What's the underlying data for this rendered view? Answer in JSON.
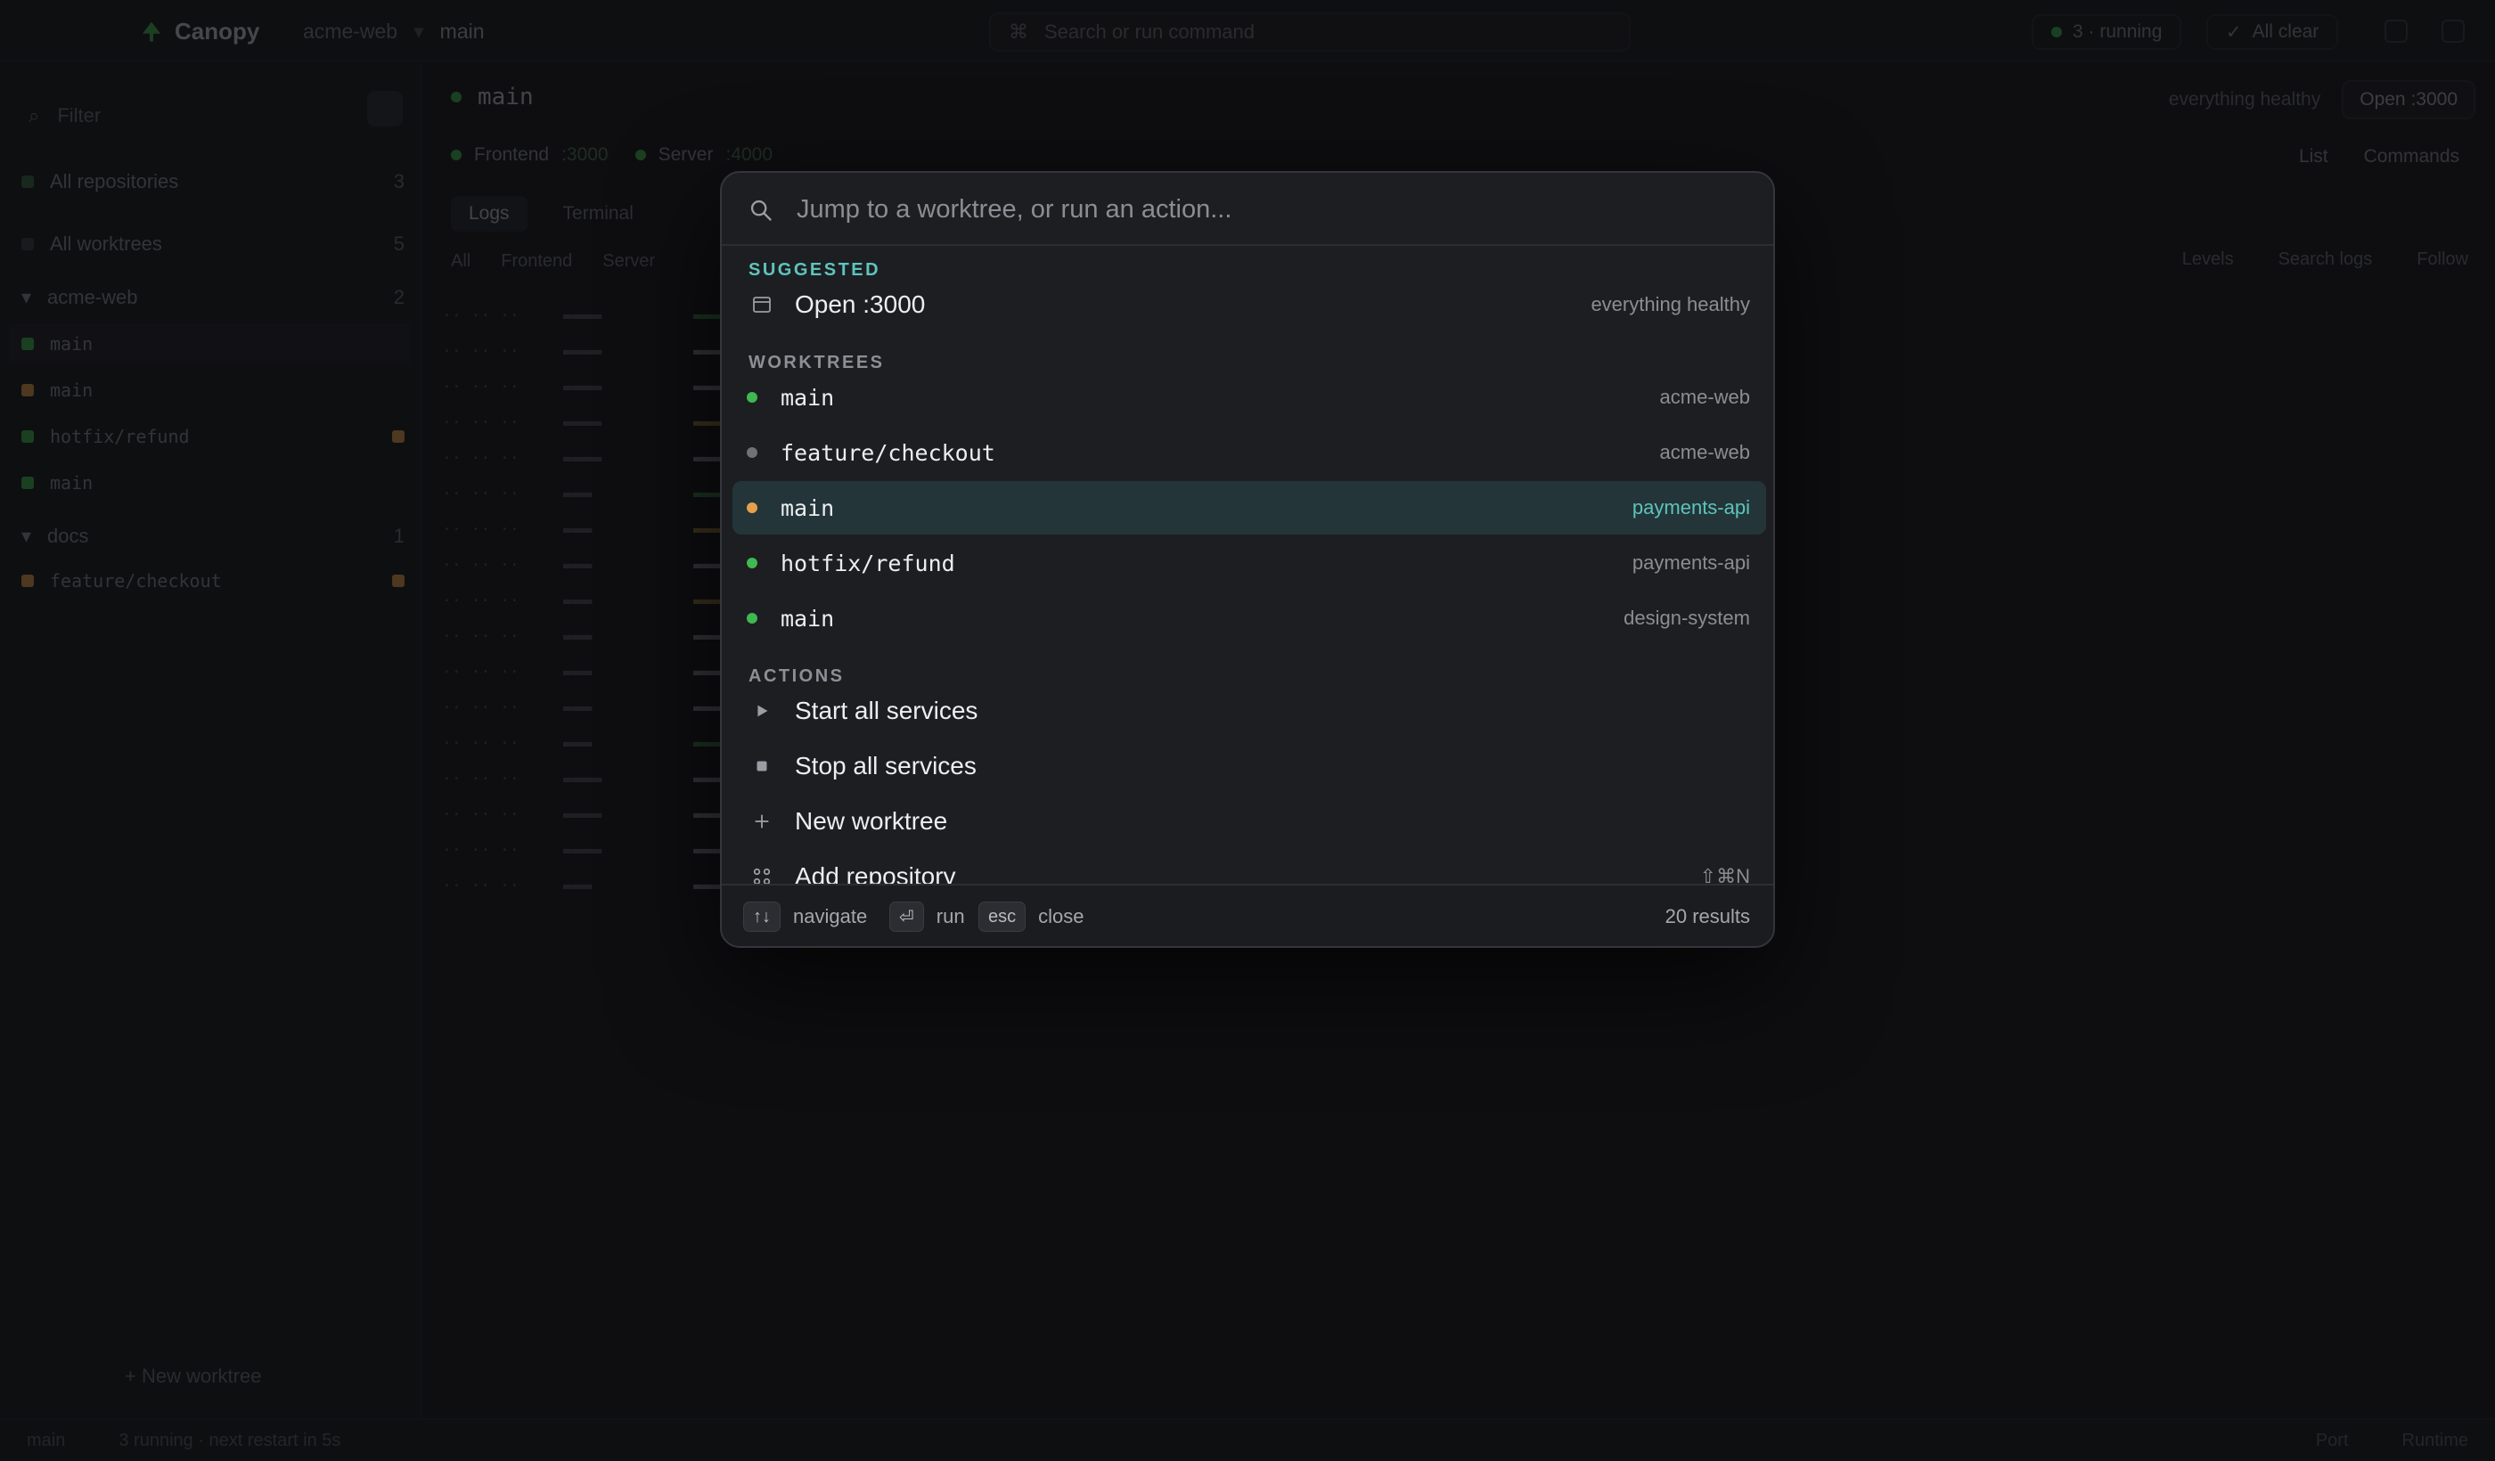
{
  "app": {
    "name": "Canopy",
    "breadcrumb": [
      "acme-web",
      "main"
    ],
    "search_placeholder": "Search or run command",
    "running_label": "3 · running",
    "all_clear_label": "All clear"
  },
  "sidebar": {
    "filter_placeholder": "Filter",
    "all_repos": {
      "label": "All repositories",
      "count": "3"
    },
    "all_worktrees": {
      "label": "All worktrees",
      "count": "5"
    },
    "groups": [
      {
        "repo": "acme-web",
        "count": "2",
        "items": [
          {
            "label": "main",
            "status": "green",
            "selected": true
          },
          {
            "label": "main",
            "status": "orange"
          },
          {
            "label": "hotfix/refund",
            "status": "green",
            "badge": true
          },
          {
            "label": "main",
            "status": "green"
          }
        ]
      },
      {
        "repo": "docs",
        "count": "1",
        "items": [
          {
            "label": "feature/checkout",
            "status": "orange",
            "badge": true
          }
        ]
      }
    ],
    "new_worktree": "New worktree"
  },
  "main": {
    "title": "main",
    "health": "everything healthy",
    "open_button": "Open :3000",
    "services": [
      {
        "name": "Frontend",
        "port": ":3000"
      },
      {
        "name": "Server",
        "port": ":4000"
      }
    ],
    "list_label": "List",
    "commands_label": "Commands",
    "log_tabs": [
      "Logs",
      "Terminal"
    ],
    "filters": [
      "All",
      "Frontend",
      "Server"
    ],
    "levels_label": "Levels",
    "search_logs_placeholder": "Search logs",
    "follow_label": "Follow"
  },
  "statusbar": {
    "left": [
      "main",
      "3 running · next restart in 5s",
      ""
    ],
    "right": [
      "Port",
      "Runtime",
      ""
    ]
  },
  "palette": {
    "placeholder": "Jump to a worktree, or run an action...",
    "sections": {
      "suggested": "SUGGESTED",
      "worktrees": "WORKTREES",
      "actions": "ACTIONS"
    },
    "suggested": [
      {
        "label": "Open :3000",
        "hint": "everything healthy",
        "icon": "browser-window-icon"
      }
    ],
    "worktrees": [
      {
        "label": "main",
        "repo": "acme-web",
        "status_color": "#3fb950"
      },
      {
        "label": "feature/checkout",
        "repo": "acme-web",
        "status_color": "#6e7177"
      },
      {
        "label": "main",
        "repo": "payments-api",
        "status_color": "#e5a04a",
        "active": true
      },
      {
        "label": "hotfix/refund",
        "repo": "payments-api",
        "status_color": "#3fb950"
      },
      {
        "label": "main",
        "repo": "design-system",
        "status_color": "#3fb950"
      }
    ],
    "actions": [
      {
        "label": "Start all services",
        "icon": "play-icon"
      },
      {
        "label": "Stop all services",
        "icon": "stop-icon"
      },
      {
        "label": "New worktree",
        "icon": "plus-icon"
      },
      {
        "label": "Add repository",
        "hint": "⇧⌘N",
        "icon": "repository-icon"
      }
    ],
    "footer": {
      "navigate_key": "↑↓",
      "navigate_label": "navigate",
      "run_key": "⏎",
      "run_label": "run",
      "close_key": "esc",
      "close_label": "close",
      "results": "20 results"
    }
  },
  "colors": {
    "accent": "#5ec4bc",
    "active_row": "#233539",
    "green": "#3fb950",
    "orange": "#e5a04a",
    "gray": "#6e7177"
  }
}
